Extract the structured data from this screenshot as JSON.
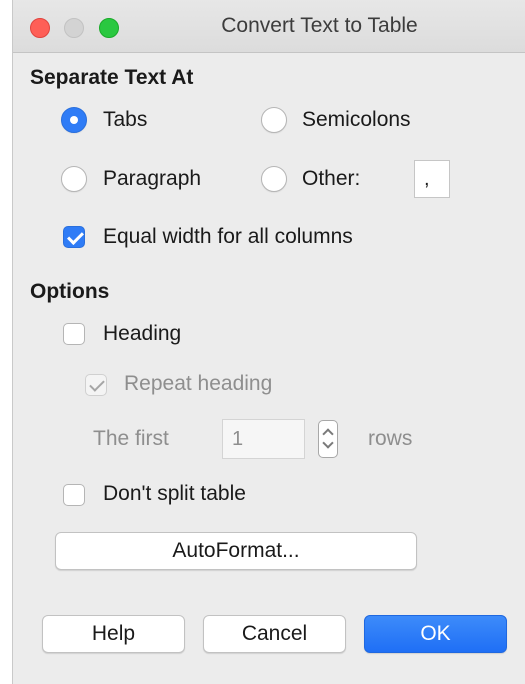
{
  "window": {
    "title": "Convert Text to Table"
  },
  "separate": {
    "section_title": "Separate Text At",
    "tabs_label": "Tabs",
    "semicolons_label": "Semicolons",
    "paragraph_label": "Paragraph",
    "other_label": "Other:",
    "other_value": ",",
    "selected": "Tabs",
    "equal_width_label": "Equal width for all columns",
    "equal_width_checked": true
  },
  "options": {
    "section_title": "Options",
    "heading_label": "Heading",
    "heading_checked": false,
    "repeat_heading_label": "Repeat heading",
    "repeat_heading_checked": true,
    "the_first_label": "The first",
    "rows_value": "1",
    "rows_label": "rows",
    "dont_split_label": "Don't split table",
    "dont_split_checked": false,
    "autoformat_label": "AutoFormat..."
  },
  "footer": {
    "help_label": "Help",
    "cancel_label": "Cancel",
    "ok_label": "OK"
  },
  "colors": {
    "accent": "#2f7cf6",
    "window_bg": "#ececec",
    "disabled_text": "#8e8e8e",
    "close_button": "#fe5f57",
    "zoom_button": "#2ac840"
  }
}
